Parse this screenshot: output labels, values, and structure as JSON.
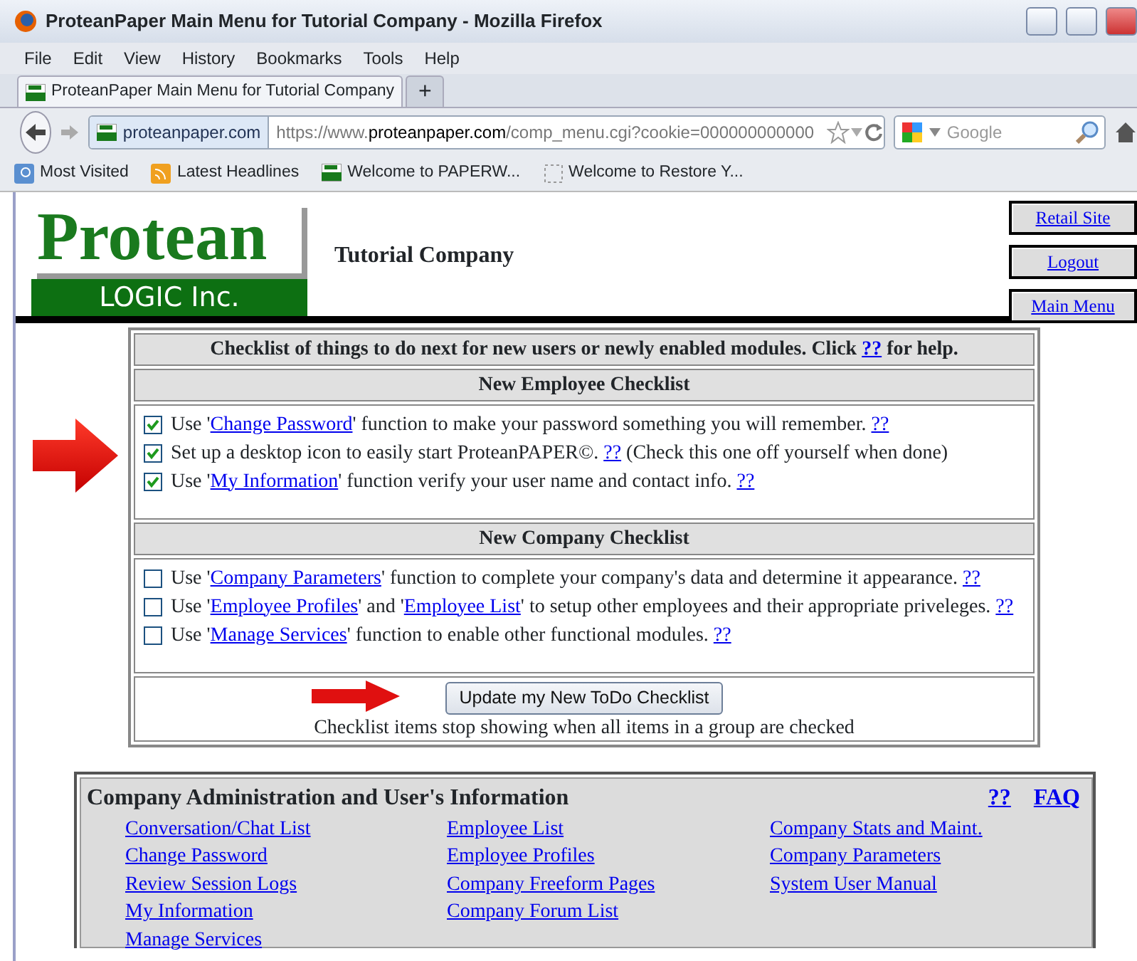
{
  "window": {
    "title": "ProteanPaper Main Menu for Tutorial Company - Mozilla Firefox"
  },
  "menu": [
    "File",
    "Edit",
    "View",
    "History",
    "Bookmarks",
    "Tools",
    "Help"
  ],
  "tabs": [
    {
      "label": "ProteanPaper Main Menu for Tutorial Company",
      "selected": true
    }
  ],
  "new_tab": "+",
  "address": {
    "site": "proteanpaper.com",
    "url_pre": "https://www.",
    "url_host": "proteanpaper.com",
    "url_post": "/comp_menu.cgi?cookie=000000000000"
  },
  "search": {
    "placeholder": "Google"
  },
  "bookmarks": [
    "Most Visited",
    "Latest Headlines",
    "Welcome to PAPERW...",
    "Welcome to Restore Y..."
  ],
  "header": {
    "logo_top": "Protean",
    "logo_bottom": "LOGIC Inc.",
    "company": "Tutorial Company",
    "side_links": [
      "Retail Site",
      "Logout",
      "Main Menu"
    ]
  },
  "checklist": {
    "intro": [
      {
        "kind": "text",
        "text": "Checklist of things to do next for new users or newly enabled modules. Click "
      },
      {
        "kind": "link",
        "text": "??"
      },
      {
        "kind": "text",
        "text": " for help."
      }
    ],
    "sections": [
      {
        "title": "New Employee Checklist",
        "items": [
          {
            "checked": true,
            "parts": [
              {
                "kind": "text",
                "text": "Use '"
              },
              {
                "kind": "link",
                "text": "Change Password"
              },
              {
                "kind": "text",
                "text": "' function to make your password something you will remember. "
              },
              {
                "kind": "link",
                "text": "??"
              }
            ]
          },
          {
            "checked": true,
            "parts": [
              {
                "kind": "text",
                "text": "Set up a desktop icon to easily start ProteanPAPER©. "
              },
              {
                "kind": "link",
                "text": "??"
              },
              {
                "kind": "text",
                "text": " (Check this one off yourself when done)"
              }
            ]
          },
          {
            "checked": true,
            "parts": [
              {
                "kind": "text",
                "text": "Use '"
              },
              {
                "kind": "link",
                "text": "My Information"
              },
              {
                "kind": "text",
                "text": "' function verify your user name and contact info. "
              },
              {
                "kind": "link",
                "text": "??"
              }
            ]
          }
        ]
      },
      {
        "title": "New Company Checklist",
        "items": [
          {
            "checked": false,
            "parts": [
              {
                "kind": "text",
                "text": "Use '"
              },
              {
                "kind": "link",
                "text": "Company Parameters"
              },
              {
                "kind": "text",
                "text": "' function to complete your company's data and determine it appearance. "
              },
              {
                "kind": "link",
                "text": "??"
              }
            ]
          },
          {
            "checked": false,
            "parts": [
              {
                "kind": "text",
                "text": "Use '"
              },
              {
                "kind": "link",
                "text": "Employee Profiles"
              },
              {
                "kind": "text",
                "text": "' and '"
              },
              {
                "kind": "link",
                "text": "Employee List"
              },
              {
                "kind": "text",
                "text": "' to setup other employees and their appropriate priveleges. "
              },
              {
                "kind": "link",
                "text": "??"
              }
            ]
          },
          {
            "checked": false,
            "parts": [
              {
                "kind": "text",
                "text": "Use '"
              },
              {
                "kind": "link",
                "text": "Manage Services"
              },
              {
                "kind": "text",
                "text": "' function to enable other functional modules. "
              },
              {
                "kind": "link",
                "text": "??"
              }
            ]
          }
        ]
      }
    ],
    "update_button": "Update my New ToDo Checklist",
    "update_note": "Checklist items stop showing when all items in a group are checked"
  },
  "admin": {
    "title": "Company Administration and User's Information",
    "help_links": [
      "??",
      "FAQ"
    ],
    "columns": [
      [
        "Conversation/Chat List",
        "Change Password",
        "Review Session Logs",
        "My Information",
        "Manage Services"
      ],
      [
        "Employee List",
        "Employee Profiles",
        "Company Freeform Pages",
        "Company Forum List"
      ],
      [
        "Company Stats and Maint.",
        "Company Parameters",
        "System User Manual"
      ]
    ]
  }
}
